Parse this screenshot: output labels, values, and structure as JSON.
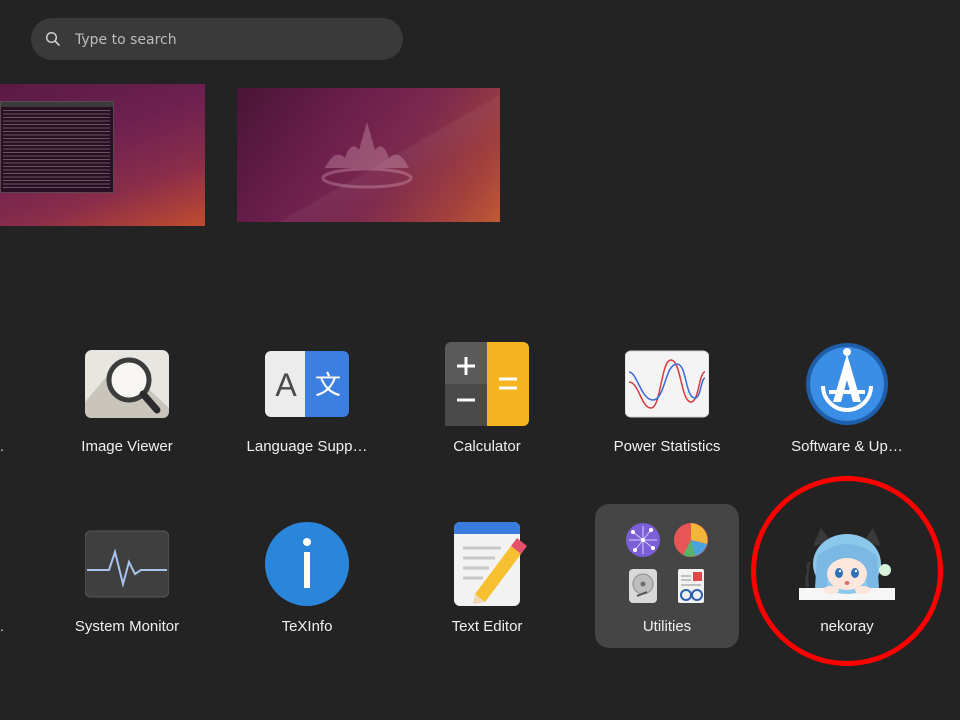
{
  "search": {
    "placeholder": "Type to search"
  },
  "edge_marker": ".",
  "apps_row1": [
    {
      "label": "Image Viewer",
      "icon": "image-viewer-icon"
    },
    {
      "label": "Language Supp…",
      "icon": "language-support-icon"
    },
    {
      "label": "Calculator",
      "icon": "calculator-icon"
    },
    {
      "label": "Power Statistics",
      "icon": "power-statistics-icon"
    },
    {
      "label": "Software & Up…",
      "icon": "software-updates-icon"
    }
  ],
  "apps_row2": [
    {
      "label": "System Monitor",
      "icon": "system-monitor-icon"
    },
    {
      "label": "TeXInfo",
      "icon": "texinfo-icon"
    },
    {
      "label": "Text Editor",
      "icon": "text-editor-icon"
    },
    {
      "label": "Utilities",
      "icon": "utilities-folder-icon"
    },
    {
      "label": "nekoray",
      "icon": "nekoray-icon"
    }
  ],
  "colors": {
    "background": "#232323",
    "highlight": "#ff0000",
    "folder": "#454545"
  }
}
